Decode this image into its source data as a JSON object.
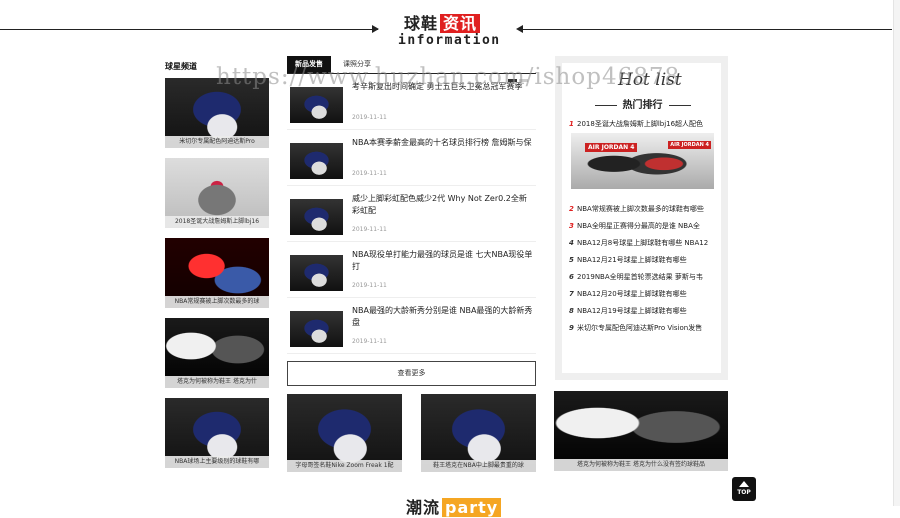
{
  "section": {
    "title_main": "球鞋",
    "title_highlight": "资讯",
    "subtitle": "information",
    "accent_color": "#e02020"
  },
  "watermark": "https://www.huzhan.com/ishop46878",
  "left_column": {
    "title": "球星频道",
    "cards": [
      {
        "caption": "米切尔专属配色阿迪达斯Pro",
        "image": "navy-shoe"
      },
      {
        "caption": "2018圣诞大战詹姆斯上脚lbj16",
        "image": "gray-shoe"
      },
      {
        "caption": "NBA常规赛被上脚次数最多的球",
        "image": "red-poster"
      },
      {
        "caption": "塔克为何被称为鞋王 塔克为什",
        "image": "dark-collage"
      },
      {
        "caption": "NBA球场上主要级别的球鞋有哪",
        "image": "navy-shoe"
      }
    ]
  },
  "middle_column": {
    "tabs": [
      {
        "label": "新品发售",
        "active": true
      },
      {
        "label": "课照分享",
        "active": false
      }
    ],
    "news": [
      {
        "title": "考辛斯复出时间确定 勇士五巨头卫冕总冠军赛季",
        "date": "2019-11-11"
      },
      {
        "title": "NBA本赛季薪金最高的十名球员排行榜 詹姆斯与保",
        "date": "2019-11-11"
      },
      {
        "title": "威少上脚彩虹配色威少2代 Why Not Zer0.2全新彩虹配",
        "date": "2019-11-11"
      },
      {
        "title": "NBA现役单打能力最强的球员是谁 七大NBA现役单打",
        "date": "2019-11-11"
      },
      {
        "title": "NBA最强的大龄新秀分别是谁 NBA最强的大龄新秀盘",
        "date": "2019-11-11"
      }
    ],
    "more_label": "查看更多",
    "bottom_cards": [
      {
        "caption": "字母哥签名鞋Nike Zoom Freak 1配",
        "image": "navy-shoe"
      },
      {
        "caption": "鞋王塔克在NBA中上脚最贵重的球",
        "image": "navy-shoe"
      }
    ]
  },
  "right_column": {
    "title_en": "Hot list",
    "title_cn": "热门排行",
    "top_item": {
      "rank": "1",
      "title": "2018圣诞大战詹姆斯上脚lbj16超人配色"
    },
    "top_image_label": "AIR JORDAN 4",
    "top_image_tag": "AIR JORDAN 4",
    "items": [
      {
        "rank": "2",
        "title": "NBA常规赛被上脚次数最多的球鞋有哪些"
      },
      {
        "rank": "3",
        "title": "NBA全明星正赛得分最高的是谁 NBA全"
      },
      {
        "rank": "4",
        "title": "NBA12月8号球星上脚球鞋有哪些 NBA12"
      },
      {
        "rank": "5",
        "title": "NBA12月21号球星上脚球鞋有哪些"
      },
      {
        "rank": "6",
        "title": "2019NBA全明星首轮票选结果 萝斯与韦"
      },
      {
        "rank": "7",
        "title": "NBA12月20号球星上脚球鞋有哪些"
      },
      {
        "rank": "8",
        "title": "NBA12月19号球星上脚球鞋有哪些"
      },
      {
        "rank": "9",
        "title": "米切尔专属配色阿迪达斯Pro Vision发售"
      }
    ],
    "bottom_card": {
      "caption": "塔克为何被称为鞋王 塔克为什么没有签约球鞋品",
      "image": "dark-collage"
    }
  },
  "top_button": "TOP",
  "next_section": {
    "title_main": "潮流",
    "title_highlight": "party"
  }
}
